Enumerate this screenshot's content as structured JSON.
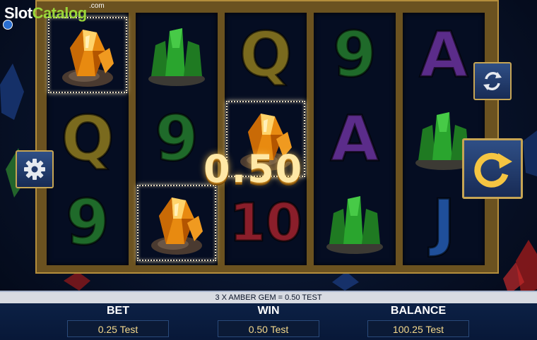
{
  "watermark": {
    "slot": "Slot",
    "catalog": "Catalog",
    "domain": ".com"
  },
  "win_popup": "0.50",
  "win_line_text": "3 X AMBER GEM = 0.50 TEST",
  "stats": {
    "bet_label": "BET",
    "bet_value": "0.25 Test",
    "win_label": "WIN",
    "win_value": "0.50 Test",
    "balance_label": "BALANCE",
    "balance_value": "100.25 Test"
  },
  "reels": [
    [
      "amber-gem",
      "Q",
      "9"
    ],
    [
      "emerald-gem",
      "9",
      "amber-gem"
    ],
    [
      "Q",
      "amber-gem",
      "10"
    ],
    [
      "9",
      "A",
      "emerald-gem"
    ],
    [
      "A",
      "emerald-gem",
      "J"
    ]
  ],
  "symbol_colors": {
    "Q": "#7a6a1e",
    "9": "#1f6a2a",
    "A": "#5b2c8a",
    "10": "#8a1e2a",
    "J": "#1f4f9a"
  },
  "icons": {
    "settings": "gear-icon",
    "autoplay": "autoplay-icon",
    "spin": "spin-icon"
  },
  "colors": {
    "frame": "#b48e3c",
    "accent_gold": "#f5c542",
    "panel": "#182b55"
  }
}
